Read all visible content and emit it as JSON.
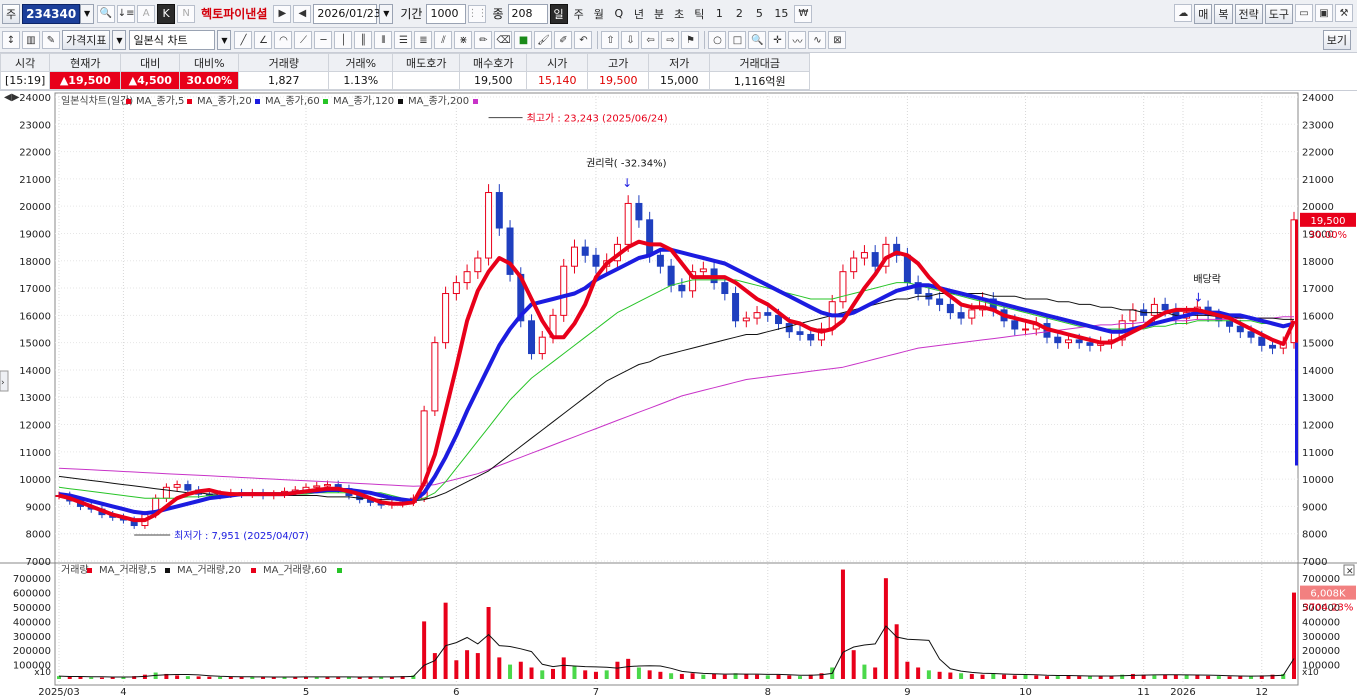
{
  "toolbar1": {
    "market_label": "주",
    "code": "234340",
    "company": "헥토파이낸셜",
    "date": "2026/01/23",
    "period_label": "기간",
    "period_value": "1000",
    "count_label": "종",
    "count_value": "208",
    "intervals": [
      "일",
      "주",
      "월",
      "Q",
      "년",
      "분",
      "초",
      "틱",
      "1",
      "2",
      "5",
      "15"
    ],
    "selected_interval": "일",
    "right_buttons": [
      "매",
      "복",
      "전략",
      "도구"
    ]
  },
  "toolbar2": {
    "indicator_label": "가격지표",
    "chart_type": "일본식 차트",
    "view_label": "보기"
  },
  "quote": {
    "headers": [
      "시각",
      "현재가",
      "대비",
      "대비%",
      "거래량",
      "거래%",
      "매도호가",
      "매수호가",
      "시가",
      "고가",
      "저가",
      "거래대금"
    ],
    "values": [
      "[15:19]",
      "▲19,500",
      "▲4,500",
      "30.00%",
      "1,827",
      "1.13%",
      "",
      "19,500",
      "15,140",
      "19,500",
      "15,000",
      "1,116억원"
    ]
  },
  "chart_data": {
    "type": "candlestick",
    "legend": [
      "일본식차트(일간)",
      "MA_종가,5",
      "MA_종가,20",
      "MA_종가,60",
      "MA_종가,120",
      "MA_종가,200"
    ],
    "y_ticks": [
      24000,
      23000,
      22000,
      21000,
      20000,
      19000,
      18000,
      17000,
      16000,
      15000,
      14000,
      13000,
      12000,
      11000,
      10000,
      9000,
      8000,
      7000
    ],
    "ylim": [
      7000,
      24000
    ],
    "x_labels": [
      "2025/03",
      "4",
      "5",
      "6",
      "7",
      "8",
      "9",
      "10",
      "11",
      "12",
      "2026"
    ],
    "annotations": {
      "high": "최고가 : 23,243 (2025/06/24)",
      "low": "최저가 : 7,951 (2025/04/07)",
      "rights": "권리락( -32.34%)",
      "dividend": "배당락"
    },
    "last_price": "19,500",
    "last_change": "30.00%",
    "close": [
      9400,
      9200,
      9000,
      8900,
      8700,
      8600,
      8500,
      8300,
      8700,
      9300,
      9700,
      9800,
      9600,
      9450,
      9400,
      9450,
      9500,
      9450,
      9500,
      9400,
      9450,
      9550,
      9600,
      9700,
      9750,
      9800,
      9650,
      9400,
      9250,
      9150,
      9050,
      9100,
      9150,
      9300,
      12500,
      15000,
      16800,
      17200,
      17600,
      18100,
      20500,
      19200,
      17500,
      15800,
      14600,
      15200,
      16000,
      17800,
      18500,
      18200,
      17800,
      18000,
      18600,
      20100,
      19500,
      18200,
      17800,
      17100,
      16900,
      17600,
      17700,
      17200,
      16800,
      15800,
      15900,
      16100,
      16000,
      15700,
      15400,
      15300,
      15100,
      15500,
      16500,
      17600,
      18100,
      18300,
      17800,
      18600,
      18200,
      17200,
      16800,
      16600,
      16400,
      16100,
      15900,
      16200,
      16600,
      16200,
      15800,
      15500,
      15500,
      15700,
      15200,
      15000,
      15100,
      15000,
      14900,
      15000,
      15100,
      15800,
      16200,
      16000,
      16400,
      16200,
      15900,
      16100,
      16300,
      16000,
      15800,
      15600,
      15400,
      15200,
      14900,
      14800,
      15000,
      19500
    ],
    "ma_short": [
      9400,
      9300,
      9150,
      9000,
      8850,
      8700,
      8600,
      8500,
      8500,
      8700,
      9000,
      9300,
      9450,
      9550,
      9600,
      9500,
      9450,
      9450,
      9450,
      9450,
      9450,
      9450,
      9500,
      9550,
      9600,
      9650,
      9650,
      9550,
      9450,
      9300,
      9150,
      9100,
      9100,
      9150,
      9850,
      10900,
      12500,
      14100,
      15800,
      16900,
      17600,
      18100,
      17900,
      17400,
      16600,
      15800,
      15200,
      15200,
      15700,
      16400,
      17400,
      17900,
      18200,
      18500,
      18700,
      18600,
      18600,
      18400,
      17900,
      17400,
      17400,
      17400,
      17400,
      17200,
      16900,
      16600,
      16400,
      16100,
      15800,
      15700,
      15500,
      15400,
      15500,
      15800,
      16400,
      17000,
      17500,
      18100,
      18300,
      18200,
      17900,
      17400,
      17000,
      16700,
      16400,
      16300,
      16300,
      16200,
      16000,
      15900,
      15800,
      15700,
      15500,
      15400,
      15300,
      15200,
      15100,
      15000,
      15000,
      15200,
      15400,
      15600,
      15900,
      16100,
      16200,
      16200,
      16200,
      16100,
      16000,
      15900,
      15700,
      15500,
      15300,
      15100,
      14950,
      15800
    ],
    "ma_mid": [
      9450,
      9400,
      9300,
      9200,
      9100,
      9000,
      8900,
      8800,
      8750,
      8800,
      8900,
      9000,
      9100,
      9200,
      9300,
      9350,
      9400,
      9450,
      9450,
      9450,
      9450,
      9450,
      9500,
      9550,
      9550,
      9600,
      9600,
      9600,
      9550,
      9500,
      9400,
      9300,
      9250,
      9200,
      9500,
      10100,
      10800,
      11600,
      12500,
      13300,
      14100,
      14900,
      15500,
      16000,
      16400,
      16500,
      16600,
      16700,
      16800,
      17000,
      17300,
      17500,
      17700,
      17900,
      18100,
      18200,
      18400,
      18400,
      18300,
      18200,
      18100,
      18000,
      17900,
      17700,
      17500,
      17300,
      17100,
      16900,
      16700,
      16500,
      16300,
      16100,
      16000,
      16000,
      16100,
      16300,
      16500,
      16700,
      16900,
      17000,
      17100,
      17100,
      17000,
      16900,
      16800,
      16700,
      16600,
      16500,
      16400,
      16300,
      16200,
      16100,
      16000,
      15900,
      15800,
      15700,
      15600,
      15500,
      15400,
      15400,
      15500,
      15600,
      15700,
      15800,
      15900,
      16000,
      16100,
      16100,
      16100,
      16000,
      16000,
      15900,
      15800,
      15700,
      15600,
      15700
    ],
    "ma_60": [
      9700,
      9650,
      9600,
      9550,
      9500,
      9450,
      9400,
      9350,
      9300,
      9300,
      9300,
      9300,
      9350,
      9350,
      9400,
      9400,
      9400,
      9450,
      9450,
      9450,
      9450,
      9450,
      9450,
      9450,
      9500,
      9500,
      9500,
      9500,
      9500,
      9500,
      9500,
      9400,
      9300,
      9200,
      9300,
      9500,
      9900,
      10400,
      10900,
      11400,
      11900,
      12400,
      12900,
      13300,
      13700,
      14000,
      14300,
      14600,
      14900,
      15200,
      15500,
      15800,
      16100,
      16300,
      16500,
      16700,
      16900,
      17100,
      17200,
      17300,
      17300,
      17300,
      17300,
      17300,
      17200,
      17100,
      17000,
      16900,
      16800,
      16700,
      16600,
      16600,
      16600,
      16700,
      16800,
      16900,
      17000,
      17100,
      17200,
      17200,
      17100,
      17000,
      16900,
      16800,
      16700,
      16600,
      16500,
      16400,
      16300,
      16200,
      16100,
      16000,
      15900,
      15800,
      15700,
      15600,
      15600,
      15500,
      15500,
      15500,
      15500,
      15500,
      15600,
      15600,
      15700,
      15700,
      15800,
      15800,
      15800,
      15800,
      15800,
      15800,
      15700,
      15700,
      15600,
      15600
    ],
    "ma_120": [
      10100,
      10050,
      10000,
      9950,
      9900,
      9850,
      9800,
      9750,
      9700,
      9650,
      9600,
      9550,
      9500,
      9500,
      9450,
      9450,
      9400,
      9400,
      9400,
      9400,
      9400,
      9400,
      9400,
      9400,
      9400,
      9350,
      9350,
      9350,
      9300,
      9300,
      9250,
      9250,
      9200,
      9200,
      9250,
      9350,
      9500,
      9700,
      9900,
      10100,
      10300,
      10600,
      10900,
      11200,
      11500,
      11800,
      12100,
      12400,
      12700,
      13000,
      13300,
      13600,
      13800,
      14000,
      14200,
      14300,
      14500,
      14600,
      14700,
      14800,
      14900,
      15000,
      15100,
      15200,
      15300,
      15300,
      15400,
      15500,
      15600,
      15700,
      15800,
      15900,
      16000,
      16100,
      16200,
      16300,
      16400,
      16500,
      16600,
      16600,
      16700,
      16700,
      16800,
      16800,
      16800,
      16800,
      16800,
      16700,
      16700,
      16700,
      16600,
      16600,
      16600,
      16500,
      16500,
      16400,
      16400,
      16300,
      16300,
      16200,
      16200,
      16100,
      16100,
      16100,
      16000,
      16000,
      16000,
      16000,
      15950,
      15950,
      15900,
      15900,
      15900,
      15900,
      15850,
      15850
    ],
    "ma_200": [
      10400,
      10380,
      10360,
      10340,
      10320,
      10300,
      10280,
      10260,
      10240,
      10220,
      10200,
      10180,
      10160,
      10140,
      10120,
      10100,
      10080,
      10060,
      10040,
      10020,
      10000,
      9980,
      9960,
      9940,
      9920,
      9900,
      9880,
      9860,
      9840,
      9820,
      9800,
      9780,
      9760,
      9740,
      9750,
      9800,
      9900,
      10000,
      10100,
      10200,
      10350,
      10500,
      10650,
      10800,
      10950,
      11100,
      11250,
      11400,
      11550,
      11700,
      11850,
      12000,
      12150,
      12300,
      12450,
      12600,
      12750,
      12900,
      13050,
      13150,
      13250,
      13350,
      13450,
      13550,
      13650,
      13700,
      13750,
      13800,
      13850,
      13900,
      13950,
      14000,
      14050,
      14100,
      14200,
      14300,
      14400,
      14500,
      14600,
      14700,
      14800,
      14850,
      14900,
      14950,
      15000,
      15050,
      15100,
      15150,
      15200,
      15250,
      15300,
      15350,
      15400,
      15450,
      15500,
      15550,
      15600,
      15650,
      15650,
      15700,
      15700,
      15750,
      15750,
      15800,
      15800,
      15800,
      15850,
      15850,
      15850,
      15850,
      15900,
      15900,
      15900,
      15900,
      15950,
      15950
    ],
    "volume_legend": [
      "거래량",
      "MA_거래량,5",
      "MA_거래량,20",
      "MA_거래량,60"
    ],
    "volume_ticks": [
      700000,
      600000,
      500000,
      400000,
      300000,
      200000,
      100000
    ],
    "volume_ylim": [
      0,
      750000
    ],
    "volume_unit": "x10",
    "volume": [
      20000,
      15000,
      18000,
      12000,
      10000,
      14000,
      16000,
      20000,
      30000,
      45000,
      35000,
      25000,
      20000,
      18000,
      16000,
      15000,
      15000,
      14000,
      15000,
      14000,
      13000,
      14000,
      15000,
      16000,
      15000,
      14000,
      13000,
      14000,
      15000,
      16000,
      14000,
      15000,
      20000,
      25000,
      400000,
      180000,
      530000,
      130000,
      200000,
      180000,
      500000,
      150000,
      100000,
      120000,
      80000,
      60000,
      70000,
      150000,
      90000,
      60000,
      50000,
      60000,
      120000,
      140000,
      80000,
      60000,
      50000,
      40000,
      35000,
      40000,
      30000,
      35000,
      30000,
      40000,
      35000,
      30000,
      25000,
      30000,
      25000,
      20000,
      30000,
      40000,
      80000,
      760000,
      200000,
      100000,
      80000,
      700000,
      380000,
      120000,
      80000,
      60000,
      50000,
      45000,
      40000,
      35000,
      30000,
      40000,
      30000,
      25000,
      30000,
      25000,
      20000,
      20000,
      25000,
      20000,
      18000,
      20000,
      22000,
      30000,
      35000,
      30000,
      25000,
      30000,
      28000,
      30000,
      25000,
      22000,
      20000,
      18000,
      20000,
      22000,
      25000,
      30000,
      35000,
      600000
    ],
    "volume_last": "6,008K",
    "volume_pct": "3704.23%"
  }
}
